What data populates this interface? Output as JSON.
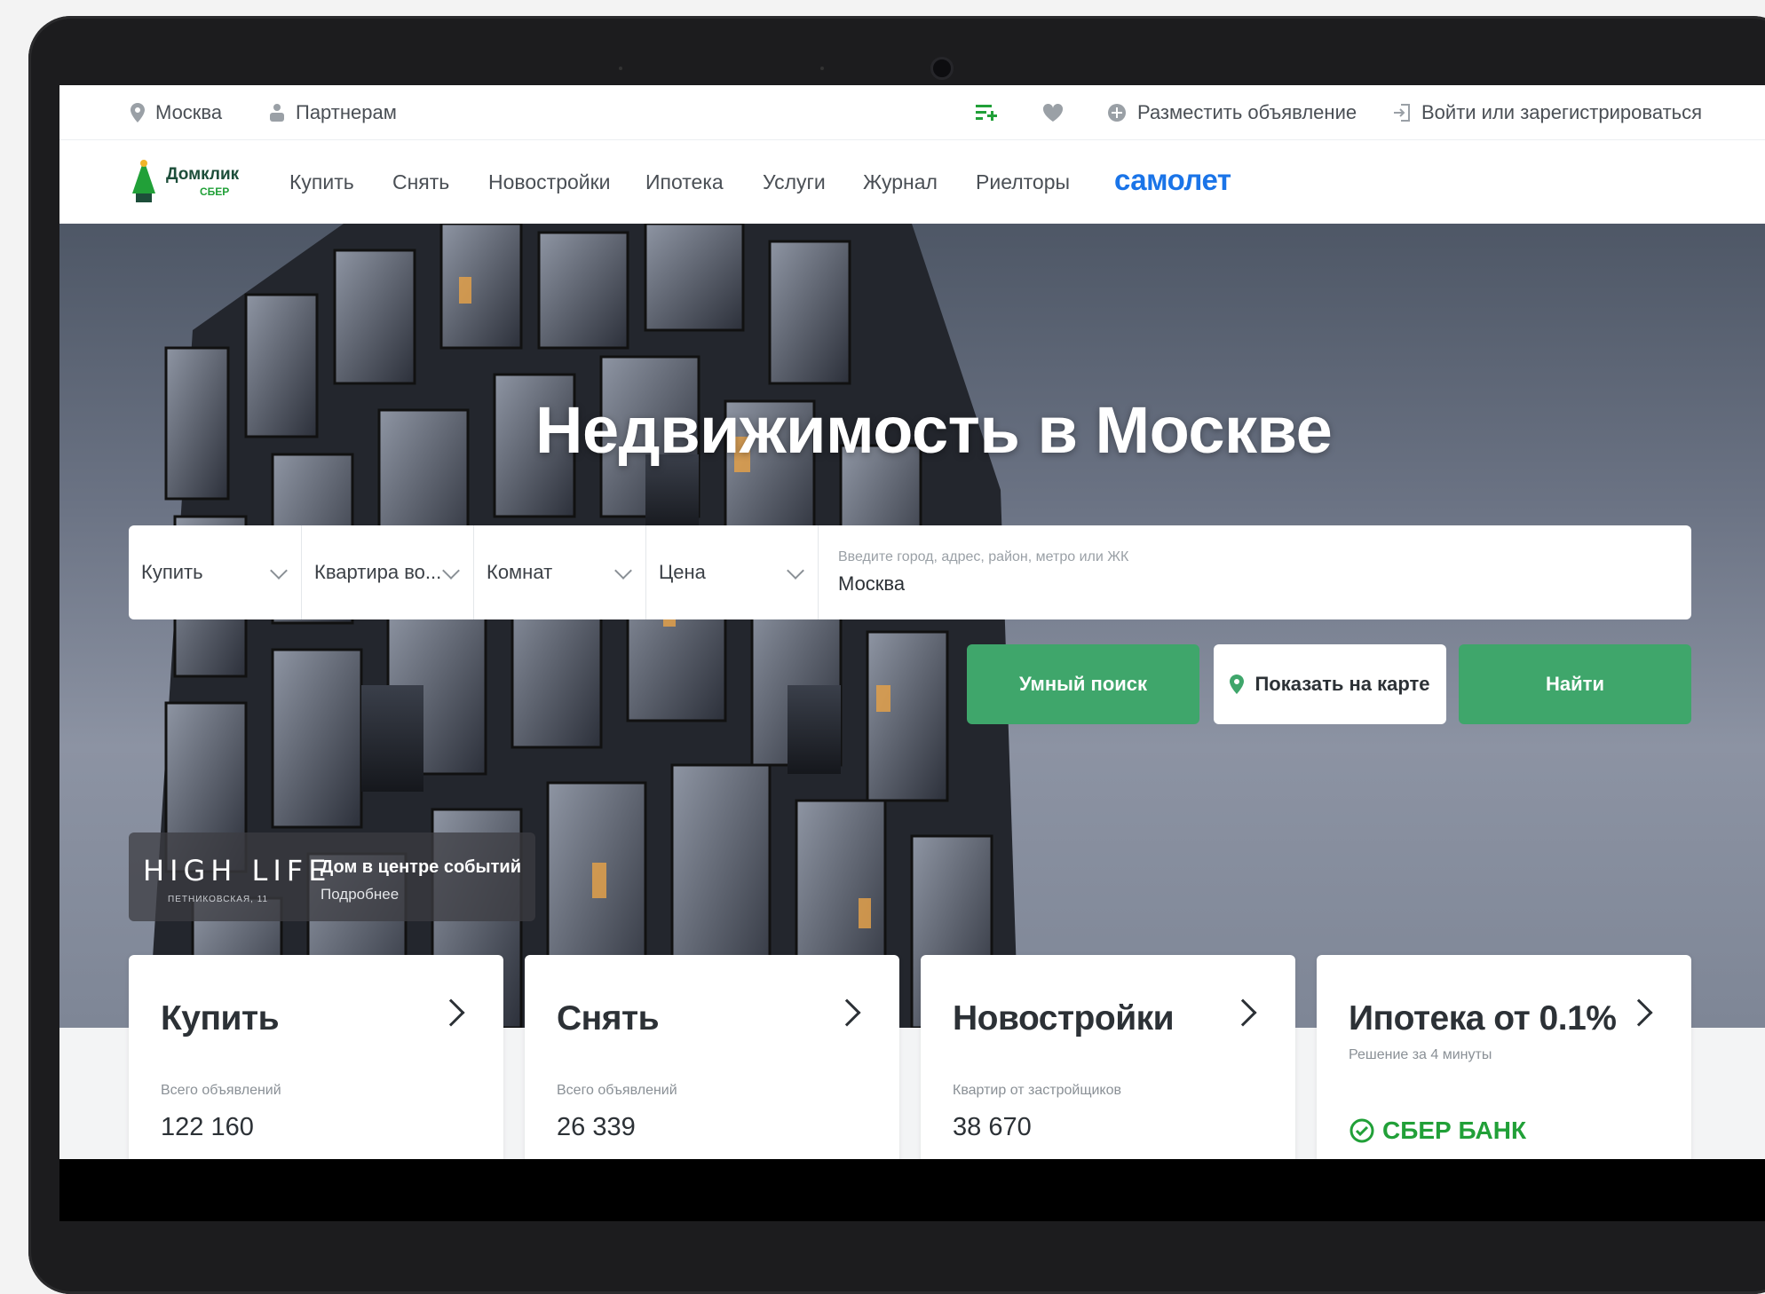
{
  "topbar": {
    "city": "Москва",
    "partners": "Партнерам",
    "place_ad": "Разместить объявление",
    "login": "Войти или зарегистрироваться"
  },
  "nav": {
    "logo_name": "Домклик",
    "logo_sub": "СБЕР",
    "items": [
      "Купить",
      "Снять",
      "Новостройки",
      "Ипотека",
      "Услуги",
      "Журнал",
      "Риелторы"
    ],
    "brand": "самолет"
  },
  "hero": {
    "title": "Недвижимость в Москве"
  },
  "search": {
    "deal": "Купить",
    "type": "Квартира во...",
    "rooms": "Комнат",
    "price": "Цена",
    "address_placeholder": "Введите город, адрес, район, метро или ЖК",
    "address_value": "Москва",
    "smart_search": "Умный поиск",
    "show_on_map": "Показать на карте",
    "find": "Найти"
  },
  "promo": {
    "brand": "HIGH LIFE",
    "address": "ПЕТНИКОВСКАЯ, 11",
    "tagline": "Дом в центре событий",
    "more": "Подробнее"
  },
  "cards": [
    {
      "title": "Купить",
      "label": "Всего объявлений",
      "value": "122 160"
    },
    {
      "title": "Снять",
      "label": "Всего объявлений",
      "value": "26 339"
    },
    {
      "title": "Новостройки",
      "label": "Квартир от застройщиков",
      "value": "38 670"
    },
    {
      "title": "Ипотека от 0.1%",
      "sub": "Решение за 4 минуты",
      "bank": "СБЕР БАНК"
    }
  ],
  "colors": {
    "accent_green": "#3fa66b",
    "brand_blue": "#1a74e8",
    "sber_green": "#21a038"
  }
}
